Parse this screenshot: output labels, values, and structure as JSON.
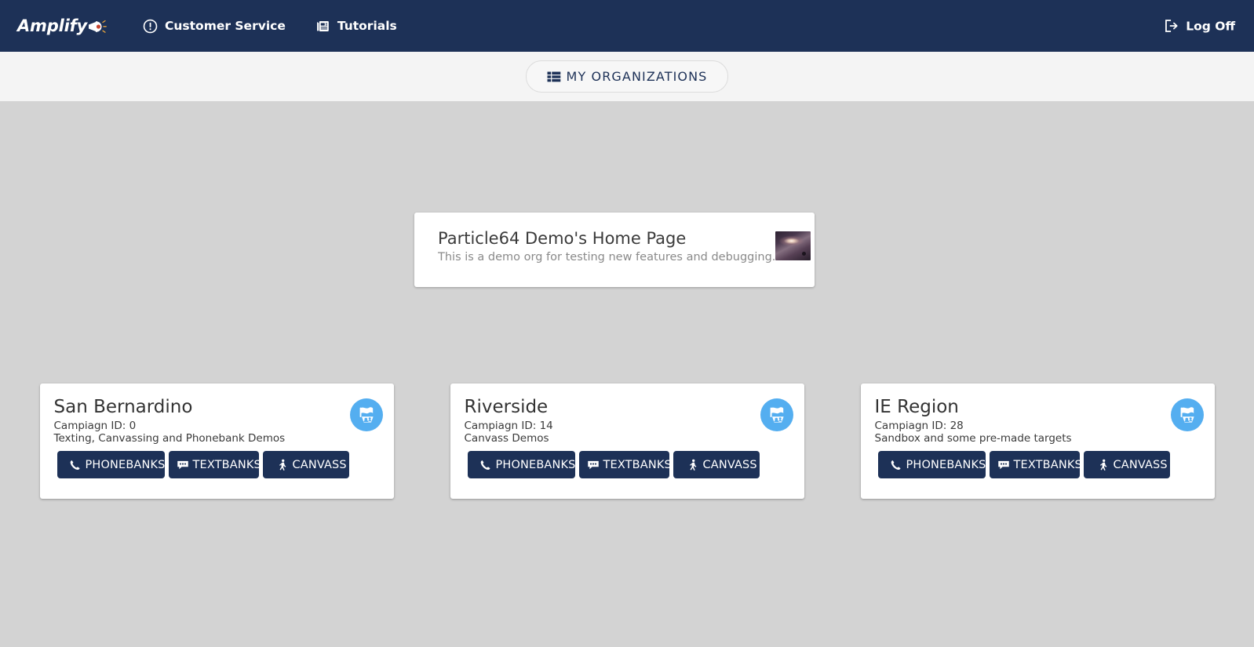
{
  "topnav": {
    "brand_text": "Amplify",
    "brand_icon": "megaphone-icon",
    "links": [
      {
        "label": "Customer Service",
        "icon": "exclamation-circle-icon"
      },
      {
        "label": "Tutorials",
        "icon": "documents-stack-icon"
      }
    ],
    "logoff_label": "Log Off",
    "logoff_icon": "sign-out-icon",
    "background_color": "#1d3157"
  },
  "subheader": {
    "my_organizations_label": "MY ORGANIZATIONS",
    "my_organizations_icon": "list-table-icon",
    "background_color": "#f4f4f4"
  },
  "org": {
    "title": "Particle64 Demo's Home Page",
    "description": "This is a demo org for testing new features and debugging.",
    "thumbnail_icon": "galaxy-thumbnail"
  },
  "campaign_actions": {
    "phonebanks_label": "PHONEBANKS",
    "phonebanks_icon": "phone-icon",
    "textbanks_label": "TEXTBANKS",
    "textbanks_icon": "comment-dots-icon",
    "canvass_label": "CANVASS",
    "canvass_icon": "walking-person-icon",
    "badge_icon": "campaign-flag-people-icon",
    "button_color": "#1d3157",
    "badge_color": "#54aef0"
  },
  "campaigns": [
    {
      "name": "San Bernardino",
      "campaign_id_label": "Campiagn ID: 0",
      "description": "Texting, Canvassing and Phonebank Demos"
    },
    {
      "name": "Riverside",
      "campaign_id_label": "Campiagn ID: 14",
      "description": "Canvass Demos"
    },
    {
      "name": "IE Region",
      "campaign_id_label": "Campiagn ID: 28",
      "description": "Sandbox and some pre-made targets"
    }
  ],
  "page": {
    "background_color": "#d3d3d3"
  }
}
